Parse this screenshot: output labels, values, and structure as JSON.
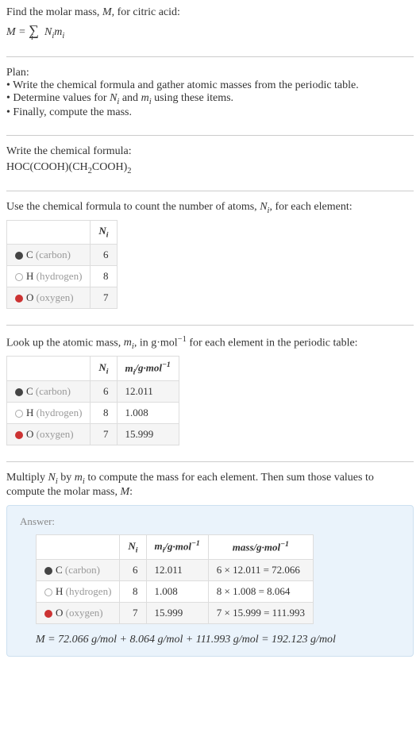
{
  "intro": {
    "line1": "Find the molar mass, M, for citric acid:",
    "formula_prefix": "M = ",
    "formula_sum": "∑",
    "formula_sub": "i",
    "formula_rest": " Nᵢmᵢ"
  },
  "plan": {
    "heading": "Plan:",
    "b1": "• Write the chemical formula and gather atomic masses from the periodic table.",
    "b2": "• Determine values for Nᵢ and mᵢ using these items.",
    "b3": "• Finally, compute the mass."
  },
  "chem": {
    "heading": "Write the chemical formula:",
    "formula_part1": "HOC(COOH)(CH",
    "formula_sub1": "2",
    "formula_part2": "COOH)",
    "formula_sub2": "2"
  },
  "count": {
    "heading": "Use the chemical formula to count the number of atoms, Nᵢ, for each element:",
    "col_n": "Nᵢ",
    "rows": [
      {
        "name": "C",
        "paren": "(carbon)",
        "swatch": "swatch-c",
        "n": "6"
      },
      {
        "name": "H",
        "paren": "(hydrogen)",
        "swatch": "swatch-h",
        "n": "8"
      },
      {
        "name": "O",
        "paren": "(oxygen)",
        "swatch": "swatch-o",
        "n": "7"
      }
    ]
  },
  "mass": {
    "heading": "Look up the atomic mass, mᵢ, in g·mol⁻¹ for each element in the periodic table:",
    "col_n": "Nᵢ",
    "col_m": "mᵢ/g·mol⁻¹",
    "rows": [
      {
        "name": "C",
        "paren": "(carbon)",
        "swatch": "swatch-c",
        "n": "6",
        "m": "12.011"
      },
      {
        "name": "H",
        "paren": "(hydrogen)",
        "swatch": "swatch-h",
        "n": "8",
        "m": "1.008"
      },
      {
        "name": "O",
        "paren": "(oxygen)",
        "swatch": "swatch-o",
        "n": "7",
        "m": "15.999"
      }
    ]
  },
  "compute": {
    "heading": "Multiply Nᵢ by mᵢ to compute the mass for each element. Then sum those values to compute the molar mass, M:"
  },
  "answer": {
    "label": "Answer:",
    "col_n": "Nᵢ",
    "col_m": "mᵢ/g·mol⁻¹",
    "col_mass": "mass/g·mol⁻¹",
    "rows": [
      {
        "name": "C",
        "paren": "(carbon)",
        "swatch": "swatch-c",
        "n": "6",
        "m": "12.011",
        "mass": "6 × 12.011 = 72.066"
      },
      {
        "name": "H",
        "paren": "(hydrogen)",
        "swatch": "swatch-h",
        "n": "8",
        "m": "1.008",
        "mass": "8 × 1.008 = 8.064"
      },
      {
        "name": "O",
        "paren": "(oxygen)",
        "swatch": "swatch-o",
        "n": "7",
        "m": "15.999",
        "mass": "7 × 15.999 = 111.993"
      }
    ],
    "final": "M = 72.066 g/mol + 8.064 g/mol + 111.993 g/mol = 192.123 g/mol"
  }
}
